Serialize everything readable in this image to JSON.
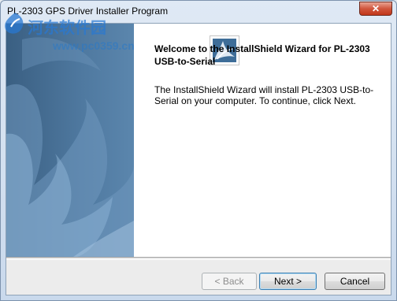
{
  "window": {
    "title": "PL-2303 GPS Driver Installer Program",
    "close_label": "✕"
  },
  "content": {
    "heading": "Welcome to the InstallShield Wizard for PL-2303 USB-to-Serial",
    "body": "The InstallShield Wizard will install PL-2303 USB-to-Serial on your computer.  To continue, click Next."
  },
  "buttons": {
    "back_label": "< Back",
    "next_label": "Next >",
    "cancel_label": "Cancel",
    "back_enabled": false
  },
  "watermark": {
    "text": "河东软件园",
    "url": "www.pc0359.cn"
  },
  "icons": {
    "setup": "installshield-setup-icon",
    "close": "close-icon",
    "logo": "watermark-logo-icon"
  },
  "colors": {
    "side_panel": "#4f79a0",
    "close_button": "#c2361a",
    "watermark": "#2878d2"
  }
}
